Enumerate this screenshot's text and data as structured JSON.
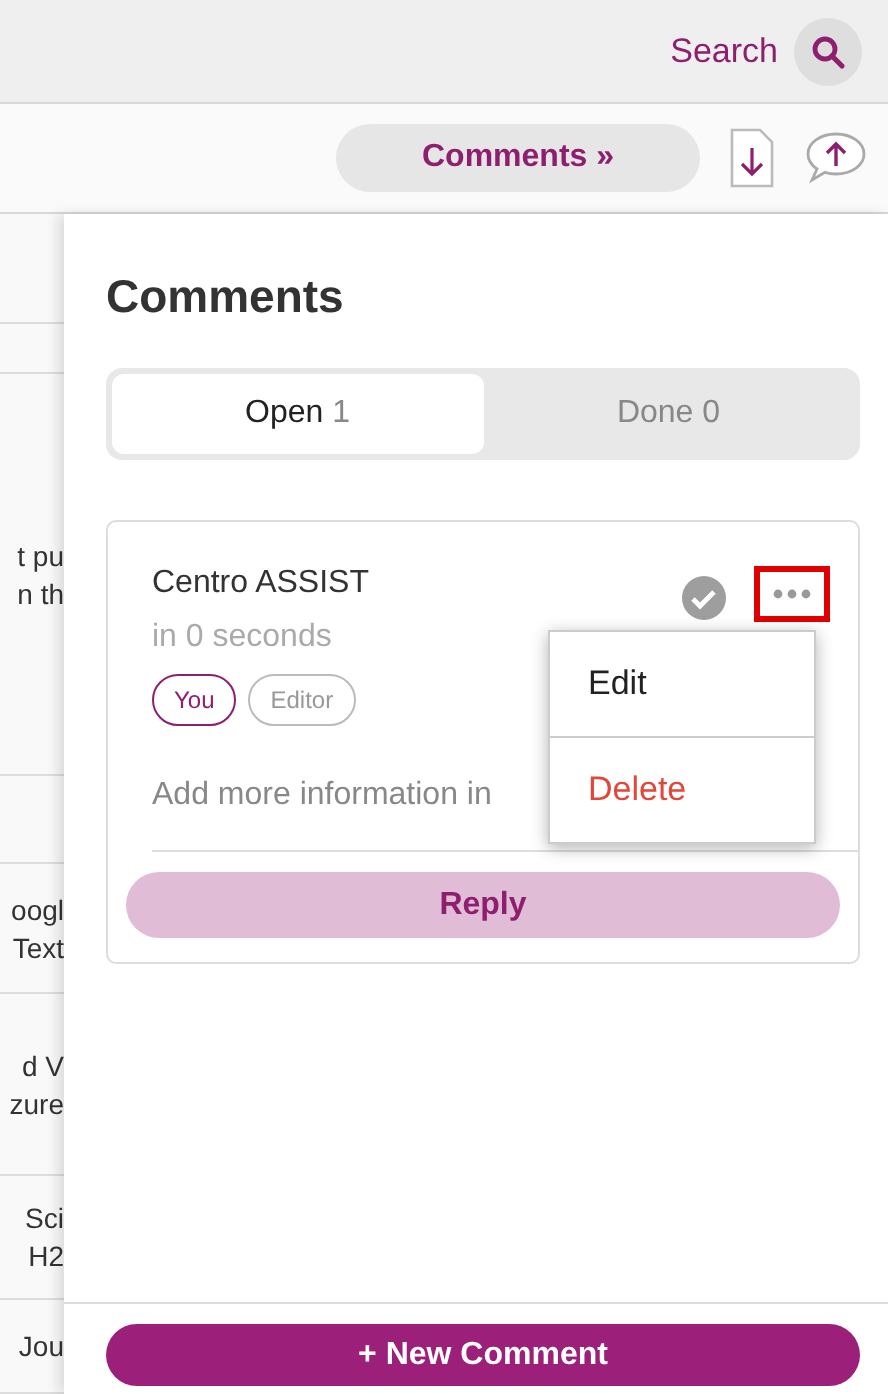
{
  "top_bar": {
    "search_label": "Search"
  },
  "toolbar": {
    "comments_button": "Comments »"
  },
  "background_rows": [
    {
      "lines": []
    },
    {
      "lines": []
    },
    {
      "lines": [
        "t pu",
        "n th"
      ]
    },
    {
      "lines": []
    },
    {
      "lines": [
        "oogl",
        "Text"
      ]
    },
    {
      "lines": [
        "d V",
        "zure"
      ]
    },
    {
      "lines": [
        "Sci",
        "H2"
      ]
    },
    {
      "lines": [
        "Jou"
      ]
    }
  ],
  "panel": {
    "title": "Comments",
    "tabs": [
      {
        "label": "Open",
        "count": "1",
        "selected": true
      },
      {
        "label": "Done",
        "count": "0",
        "selected": false
      }
    ],
    "comments": [
      {
        "author": "Centro ASSIST",
        "time": "in 0 seconds",
        "resolved": false,
        "more_highlighted": true,
        "tags": [
          {
            "label": "You",
            "kind": "self"
          },
          {
            "label": "Editor",
            "kind": "role"
          }
        ],
        "body": "Add more information in",
        "menu": [
          {
            "label": "Edit",
            "kind": "normal"
          },
          {
            "label": "Delete",
            "kind": "danger"
          }
        ],
        "reply_button": "Reply"
      }
    ],
    "new_button": "+ New Comment"
  }
}
